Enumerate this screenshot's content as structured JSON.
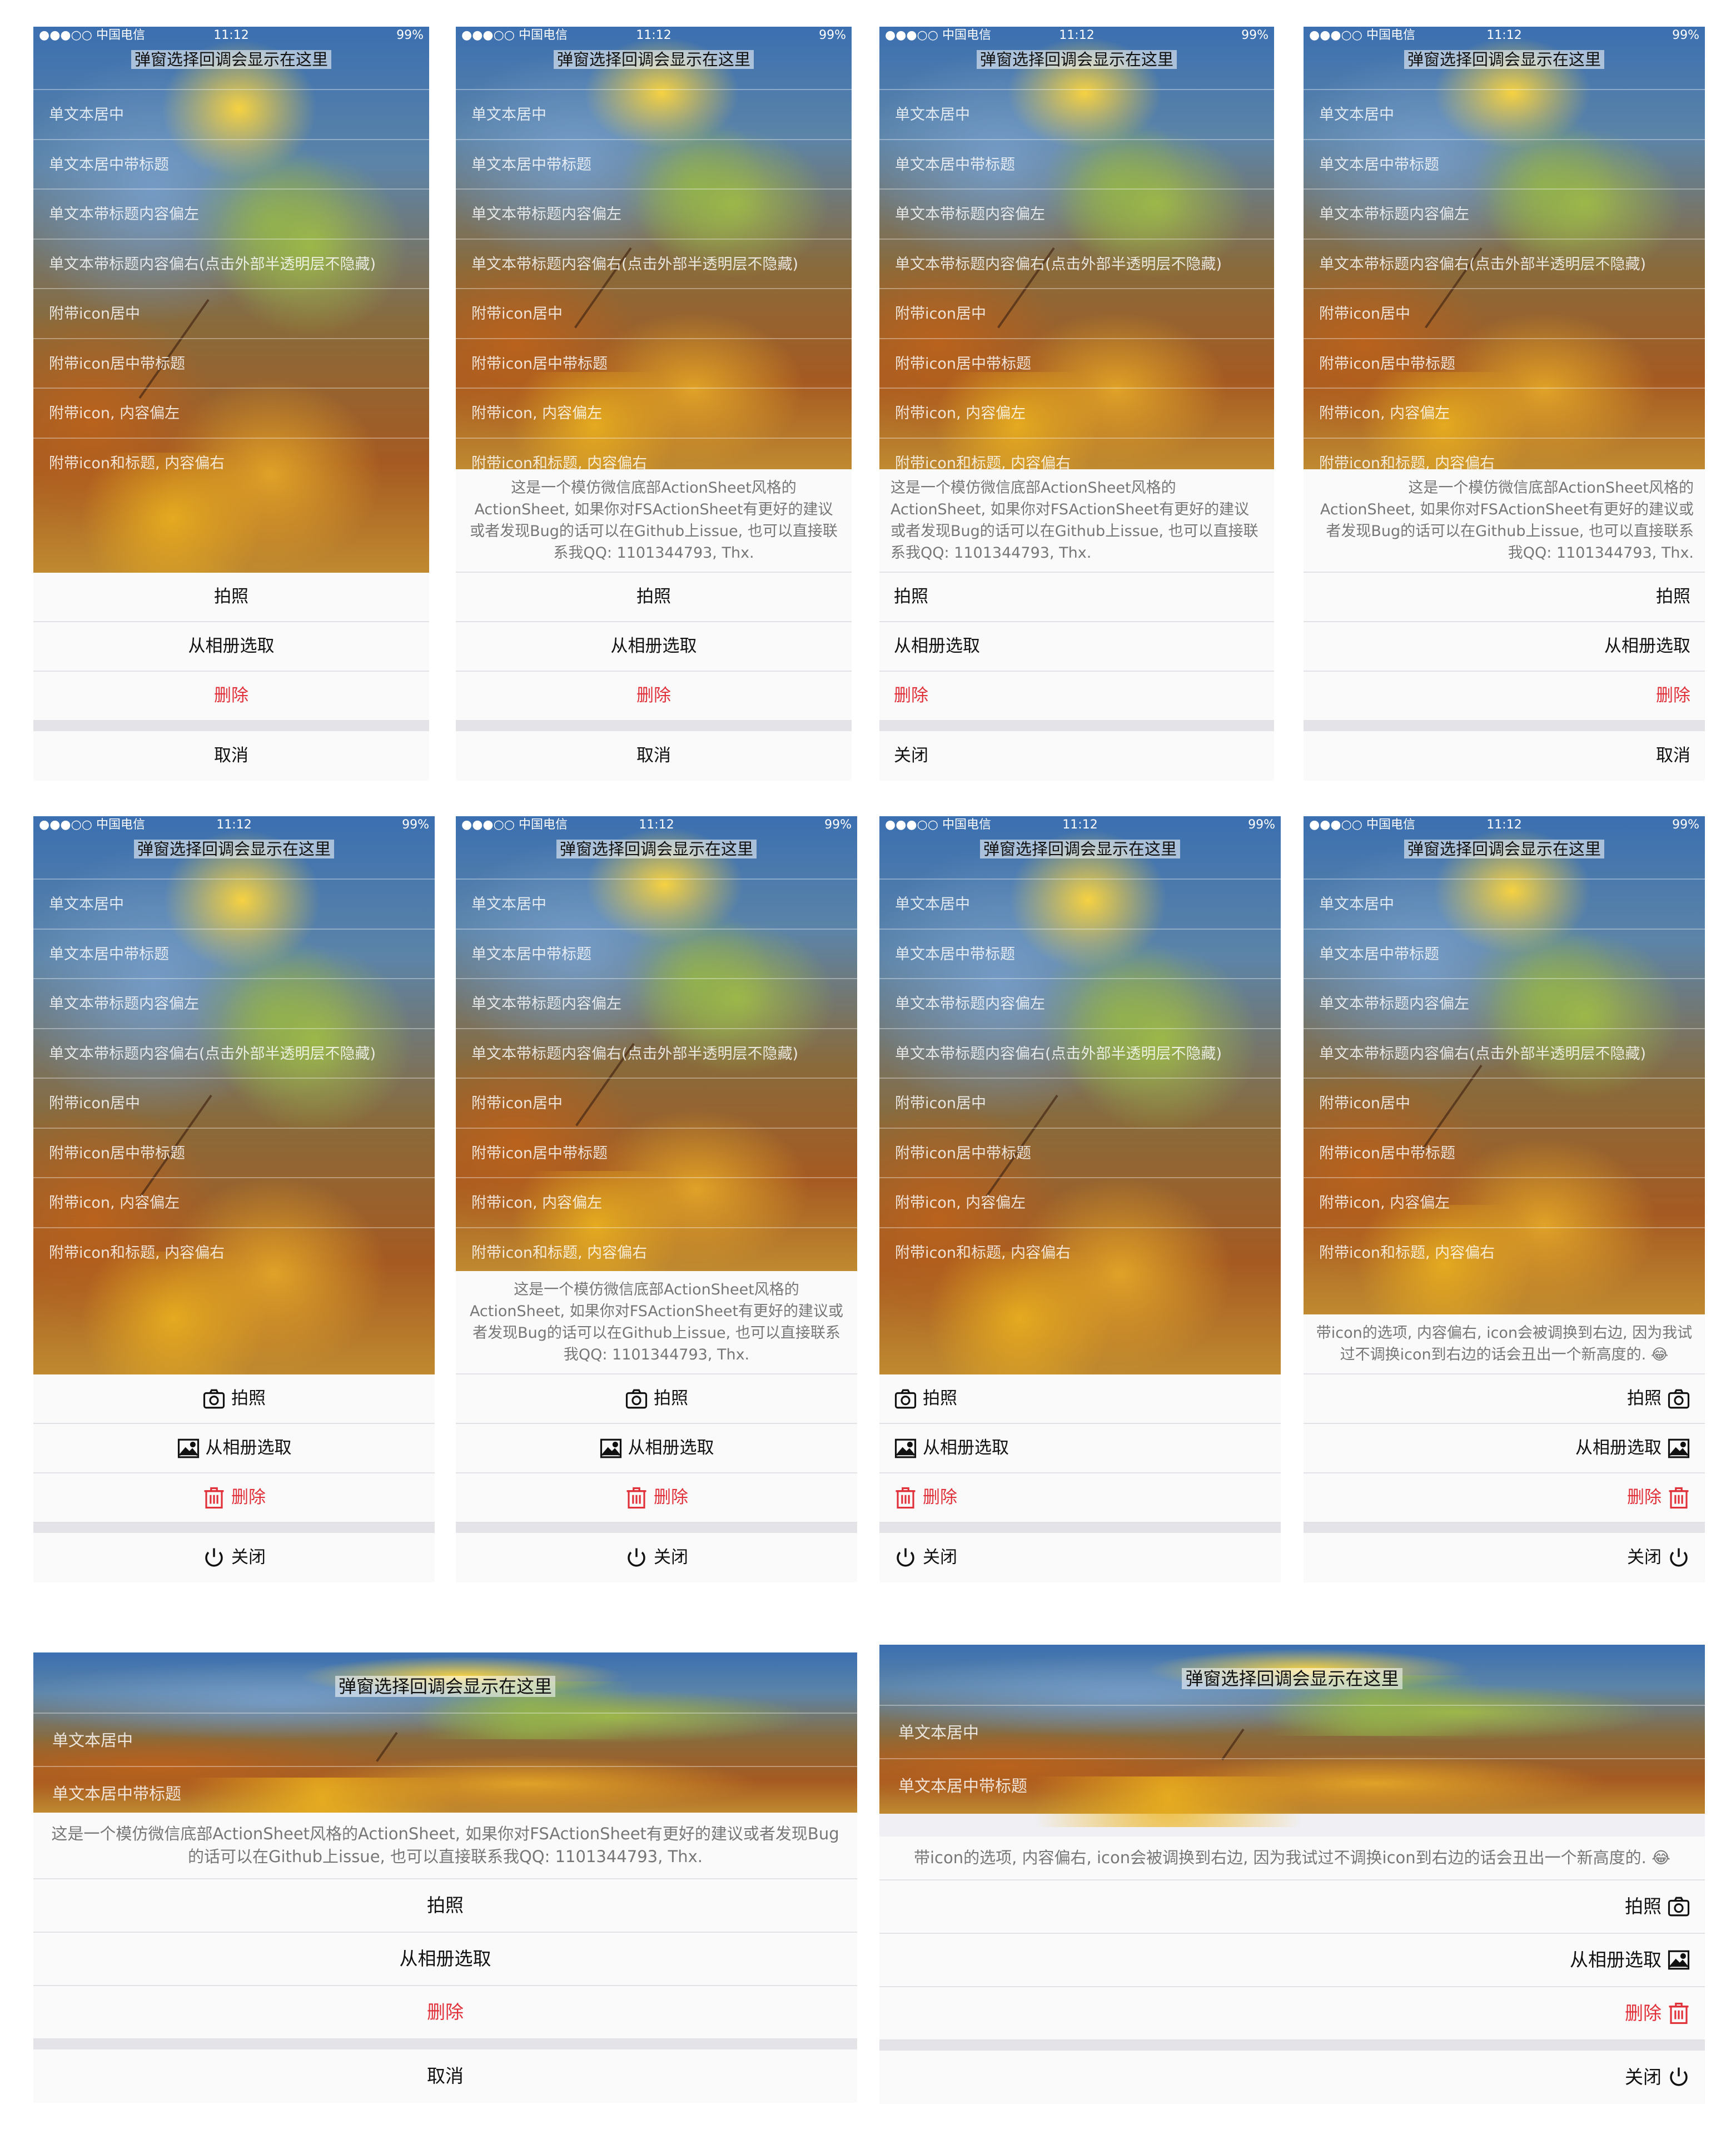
{
  "status": {
    "carrier": "●●●○○ 中国电信",
    "time": "11:12",
    "battery": "99%"
  },
  "callback_label": "弹窗选择回调会显示在这里",
  "table_rows": [
    "单文本居中",
    "单文本居中带标题",
    "单文本带标题内容偏左",
    "单文本带标题内容偏右(点击外部半透明层不隐藏)",
    "附带icon居中",
    "附带icon居中带标题",
    "附带icon, 内容偏左",
    "附带icon和标题, 内容偏右"
  ],
  "sheet": {
    "title_wechat": "这是一个模仿微信底部ActionSheet风格的ActionSheet, 如果你对FSActionSheet有更好的建议或者发现Bug的话可以在Github上issue, 也可以直接联系我QQ: 1101344793, Thx.",
    "title_icon": "带icon的选项, 内容偏右, icon会被调换到右边, 因为我试过不调换icon到右边的话会丑出一个新高度的. 😂",
    "photo": "拍照",
    "album": "从相册选取",
    "delete": "删除",
    "cancel": "取消",
    "close": "关闭"
  },
  "icons": {
    "photo": "camera-icon",
    "album": "image-icon",
    "delete": "trash-icon",
    "close": "power-icon"
  },
  "colors": {
    "destructive": "#e0313a",
    "sheet_bg": "#fafafa",
    "separator": "#e2e2e6"
  }
}
